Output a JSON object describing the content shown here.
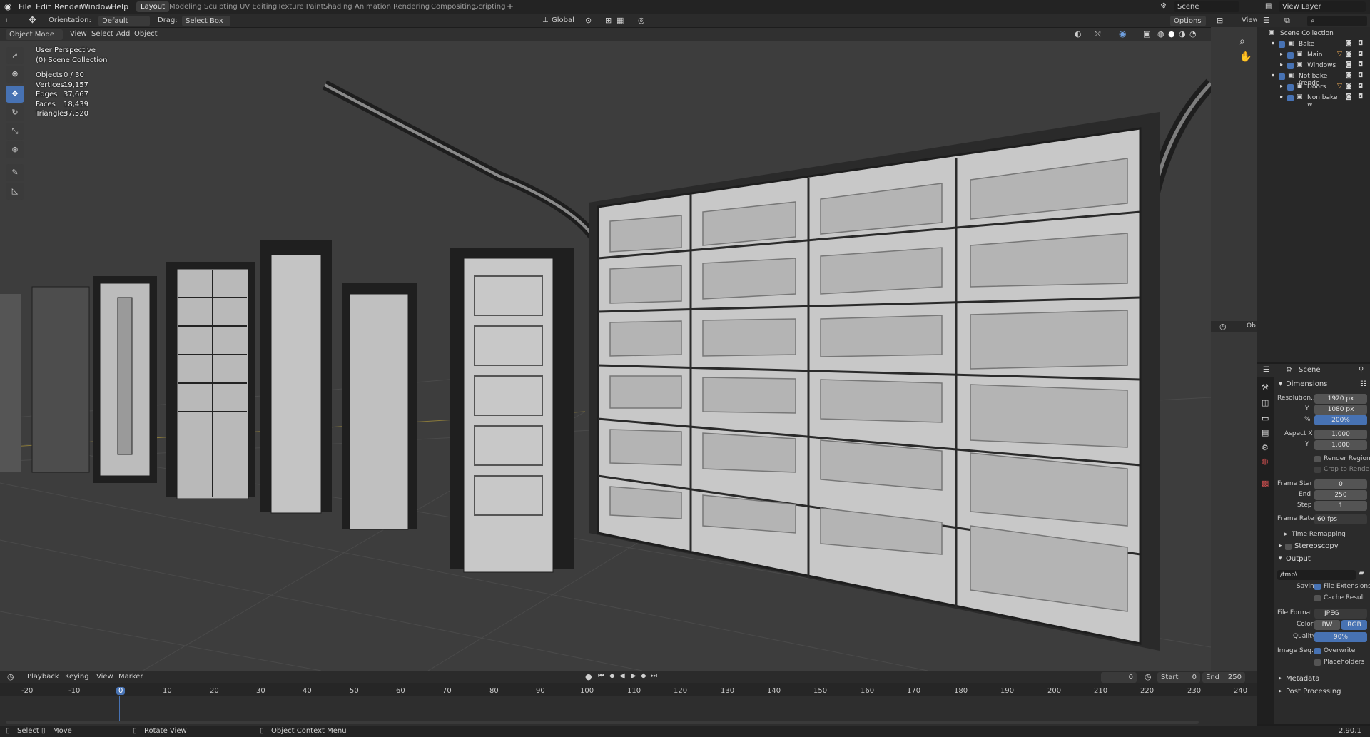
{
  "colors": {
    "accent": "#4772b3",
    "viewport_bg": "#3d3d3d",
    "panel_bg": "#2b2b2b"
  },
  "menu": {
    "file": "File",
    "edit": "Edit",
    "render": "Render",
    "window": "Window",
    "help": "Help"
  },
  "workspaces": [
    "Layout",
    "Modeling",
    "Sculpting",
    "UV Editing",
    "Texture Paint",
    "Shading",
    "Animation",
    "Rendering",
    "Compositing",
    "Scripting"
  ],
  "top_right": {
    "scene": "Scene",
    "view_layer": "View Layer"
  },
  "tool_header": {
    "orientation_label": "Orientation:",
    "orientation_value": "Default",
    "drag_label": "Drag:",
    "drag_value": "Select Box",
    "transform_orientation": "Global",
    "options": "Options"
  },
  "viewport_header": {
    "mode": "Object Mode",
    "view": "View",
    "select": "Select",
    "add": "Add",
    "object": "Object"
  },
  "overlay": {
    "perspective": "User Perspective",
    "collection": "(0) Scene Collection",
    "stats": [
      {
        "label": "Objects",
        "value": "0 / 30"
      },
      {
        "label": "Vertices",
        "value": "19,157"
      },
      {
        "label": "Edges",
        "value": "37,667"
      },
      {
        "label": "Faces",
        "value": "18,439"
      },
      {
        "label": "Triangles",
        "value": "37,520"
      }
    ]
  },
  "outliner": {
    "root": "Scene Collection",
    "view_label": "View",
    "items": [
      {
        "label": "Bake"
      },
      {
        "label": "Main"
      },
      {
        "label": "Windows"
      },
      {
        "label": "Not bake (rende"
      },
      {
        "label": "Doors"
      },
      {
        "label": "Non bake w"
      }
    ]
  },
  "properties": {
    "context": "Scene",
    "dimensions": "Dimensions",
    "resolution_label": "Resolution...",
    "res_x": "1920 px",
    "y_label": "Y",
    "res_y": "1080 px",
    "pct_label": "%",
    "res_pct": "200%",
    "aspect_label": "Aspect X",
    "aspect_x": "1.000",
    "aspect_y": "1.000",
    "render_region": "Render Region",
    "crop": "Crop to Rende...",
    "frame_start_label": "Frame Star",
    "frame_start": "0",
    "end_label": "End",
    "frame_end": "250",
    "step_label": "Step",
    "step": "1",
    "frame_rate_label": "Frame Rate",
    "frame_rate": "60 fps",
    "time_remapping": "Time Remapping",
    "stereoscopy": "Stereoscopy",
    "output": "Output",
    "path": "/tmp\\",
    "saving_label": "Saving",
    "file_extensions": "File Extensions",
    "cache_result": "Cache Result",
    "file_format_label": "File Format",
    "file_format": "JPEG",
    "color_label": "Color",
    "bw": "BW",
    "rgb": "RGB",
    "quality_label": "Quality",
    "quality": "90%",
    "image_seq_label": "Image Seq...",
    "overwrite": "Overwrite",
    "placeholders": "Placeholders",
    "metadata": "Metadata",
    "post_processing": "Post Processing"
  },
  "timeline": {
    "playback": "Playback",
    "keying": "Keying",
    "view": "View",
    "marker": "Marker",
    "current_frame": "0",
    "start_label": "Start",
    "start": "0",
    "end_label": "End",
    "end": "250",
    "ticks": [
      "-20",
      "-10",
      "0",
      "10",
      "20",
      "30",
      "40",
      "50",
      "60",
      "70",
      "80",
      "90",
      "100",
      "110",
      "120",
      "130",
      "140",
      "150",
      "160",
      "170",
      "180",
      "190",
      "200",
      "210",
      "220",
      "230",
      "240"
    ]
  },
  "statusbar": {
    "select": "Select",
    "move": "Move",
    "rotate": "Rotate View",
    "context_menu": "Object Context Menu",
    "version": "2.90.1"
  },
  "side_header": {
    "object_short": "Ob"
  }
}
